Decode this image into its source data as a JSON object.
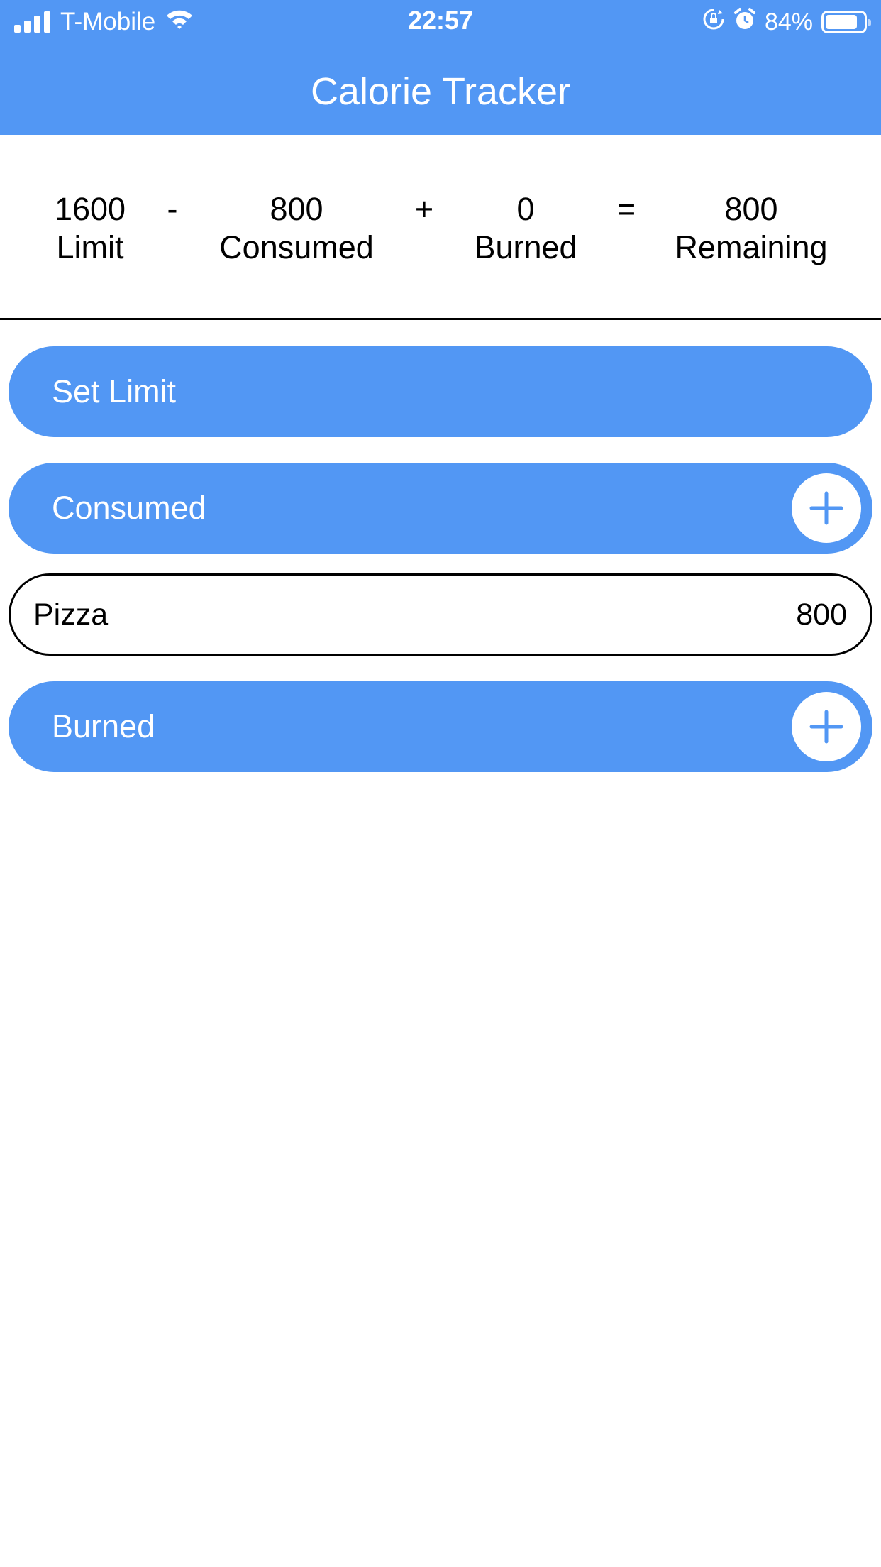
{
  "status_bar": {
    "carrier": "T-Mobile",
    "time": "22:57",
    "battery": "84%",
    "battery_level": 0.84
  },
  "header": {
    "title": "Calorie Tracker"
  },
  "summary": {
    "limit_value": "1600",
    "limit_label": "Limit",
    "op_minus": "-",
    "consumed_value": "800",
    "consumed_label": "Consumed",
    "op_plus": "+",
    "burned_value": "0",
    "burned_label": "Burned",
    "op_equals": "=",
    "remaining_value": "800",
    "remaining_label": "Remaining"
  },
  "sections": {
    "set_limit_label": "Set Limit",
    "consumed_label": "Consumed",
    "burned_label": "Burned"
  },
  "consumed_items": [
    {
      "name": "Pizza",
      "calories": "800"
    }
  ],
  "colors": {
    "accent": "#5297f4",
    "text": "#000000",
    "background": "#ffffff"
  },
  "icons": [
    "signal-icon",
    "wifi-icon",
    "orientation-lock-icon",
    "alarm-icon",
    "battery-icon",
    "plus-icon"
  ]
}
